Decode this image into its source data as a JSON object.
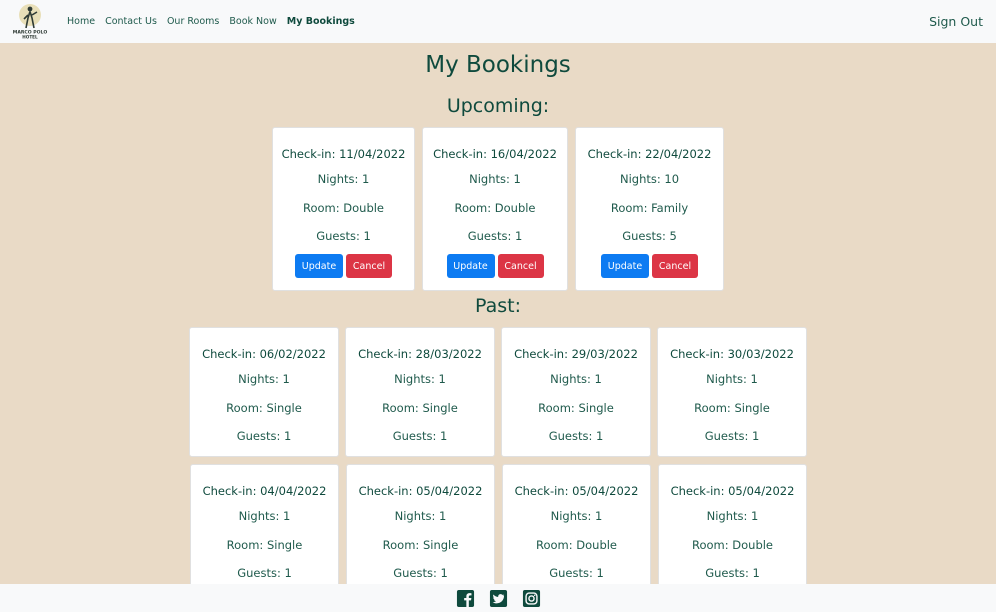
{
  "nav": {
    "logo_text": "MARCO POLO HOTEL",
    "links": [
      "Home",
      "Contact Us",
      "Our Rooms",
      "Book Now",
      "My Bookings"
    ],
    "active": "My Bookings",
    "signout": "Sign Out"
  },
  "page": {
    "title": "My Bookings",
    "upcoming_title": "Upcoming:",
    "past_title": "Past:"
  },
  "actions": {
    "update": "Update",
    "cancel": "Cancel"
  },
  "upcoming": [
    {
      "checkin": "Check-in: 11/04/2022",
      "nights": "Nights: 1",
      "room": "Room: Double",
      "guests": "Guests: 1"
    },
    {
      "checkin": "Check-in: 16/04/2022",
      "nights": "Nights: 1",
      "room": "Room: Double",
      "guests": "Guests: 1"
    },
    {
      "checkin": "Check-in: 22/04/2022",
      "nights": "Nights: 10",
      "room": "Room: Family",
      "guests": "Guests: 5"
    }
  ],
  "past": [
    {
      "checkin": "Check-in: 06/02/2022",
      "nights": "Nights: 1",
      "room": "Room: Single",
      "guests": "Guests: 1"
    },
    {
      "checkin": "Check-in: 28/03/2022",
      "nights": "Nights: 1",
      "room": "Room: Single",
      "guests": "Guests: 1"
    },
    {
      "checkin": "Check-in: 29/03/2022",
      "nights": "Nights: 1",
      "room": "Room: Single",
      "guests": "Guests: 1"
    },
    {
      "checkin": "Check-in: 30/03/2022",
      "nights": "Nights: 1",
      "room": "Room: Single",
      "guests": "Guests: 1"
    },
    {
      "checkin": "Check-in: 04/04/2022",
      "nights": "Nights: 1",
      "room": "Room: Single",
      "guests": "Guests: 1"
    },
    {
      "checkin": "Check-in: 05/04/2022",
      "nights": "Nights: 1",
      "room": "Room: Single",
      "guests": "Guests: 1"
    },
    {
      "checkin": "Check-in: 05/04/2022",
      "nights": "Nights: 1",
      "room": "Room: Double",
      "guests": "Guests: 1"
    },
    {
      "checkin": "Check-in: 05/04/2022",
      "nights": "Nights: 1",
      "room": "Room: Double",
      "guests": "Guests: 1"
    }
  ],
  "footer": {
    "icons": [
      "facebook-icon",
      "twitter-icon",
      "instagram-icon"
    ]
  },
  "colors": {
    "background": "#e9dac6",
    "text": "#1f5a4c",
    "update": "#0d7bf2",
    "cancel": "#dc3545",
    "navbar": "#f8f9fa"
  }
}
